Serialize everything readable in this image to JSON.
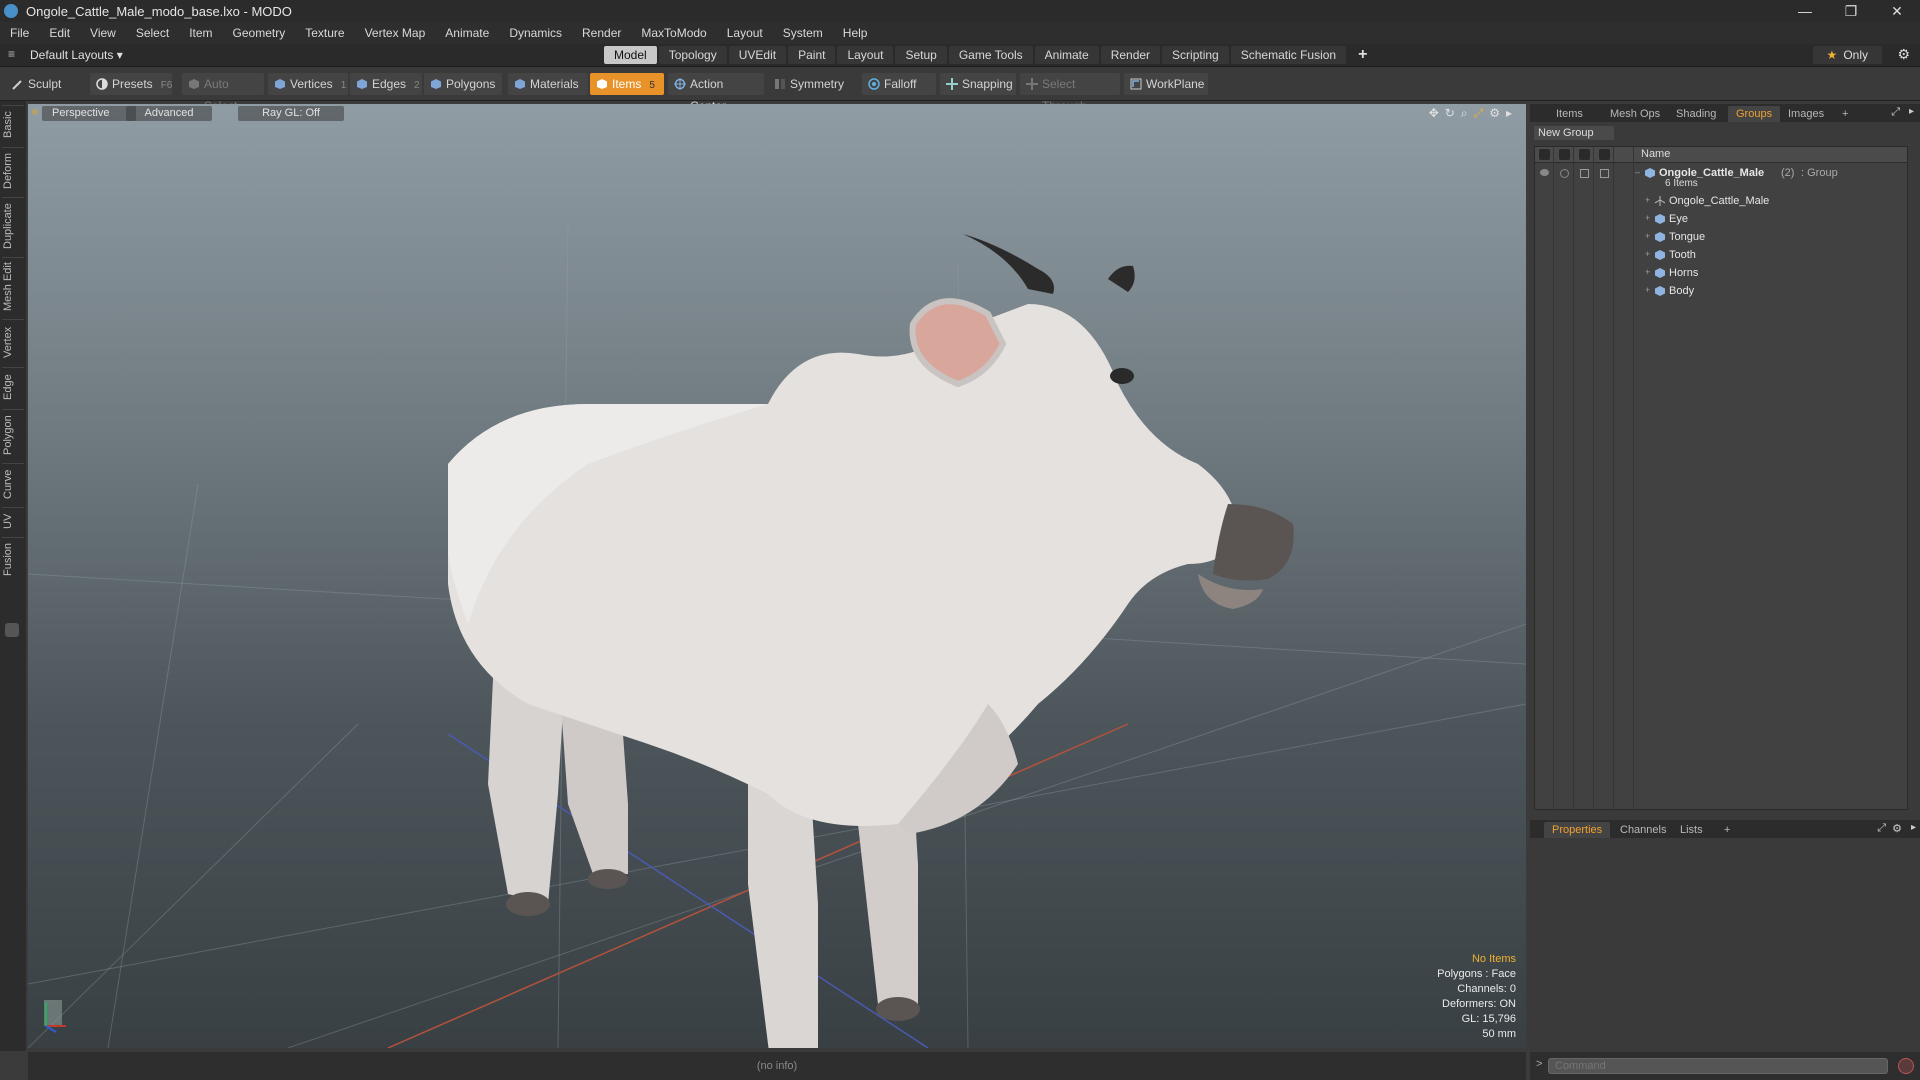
{
  "window": {
    "title": "Ongole_Cattle_Male_modo_base.lxo - MODO",
    "minimize": "—",
    "restore": "❐",
    "close": "✕"
  },
  "menu": [
    "File",
    "Edit",
    "View",
    "Select",
    "Item",
    "Geometry",
    "Texture",
    "Vertex Map",
    "Animate",
    "Dynamics",
    "Render",
    "MaxToModo",
    "Layout",
    "System",
    "Help"
  ],
  "layoutbar": {
    "layout_select": "Default Layouts ▾",
    "tabs": [
      "Model",
      "Topology",
      "UVEdit",
      "Paint",
      "Layout",
      "Setup",
      "Game Tools",
      "Animate",
      "Render",
      "Scripting",
      "Schematic Fusion"
    ],
    "active_tab": "Model",
    "add_tab": "+",
    "only_label": "Only",
    "star": "★",
    "gear": "⚙"
  },
  "toolbar": {
    "sculpt": "Sculpt",
    "presets": "Presets",
    "presets_key": "F6",
    "auto_select": "Auto Select",
    "vertices": "Vertices",
    "vertices_key": "1",
    "edges": "Edges",
    "edges_key": "2",
    "polygons": "Polygons",
    "materials": "Materials",
    "items": "Items",
    "items_key": "5",
    "action_center": "Action Center",
    "symmetry": "Symmetry",
    "falloff": "Falloff",
    "snapping": "Snapping",
    "select_through": "Select Through",
    "workplane": "WorkPlane"
  },
  "left_tabs": [
    "Basic",
    "Deform",
    "Duplicate",
    "Mesh Edit",
    "Vertex",
    "Edge",
    "Polygon",
    "Curve",
    "UV",
    "Fusion"
  ],
  "viewport": {
    "perspective": "Perspective",
    "advanced": "Advanced",
    "raygl": "Ray GL: Off",
    "info": {
      "no_items": "No Items",
      "polygons": "Polygons : Face",
      "channels": "Channels: 0",
      "deformers": "Deformers: ON",
      "gl": "GL: 15,796",
      "focal": "50 mm"
    },
    "colors": {
      "model": "#e4e1df",
      "model_shadow": "#b4afac",
      "hoof": "#5a5553",
      "horn": "#2b2b2b",
      "ear_inner": "#d9a69c"
    }
  },
  "status": {
    "info": "(no info)"
  },
  "right_panel": {
    "tabs": [
      "Items",
      "Mesh Ops",
      "Shading",
      "Groups",
      "Images",
      "+"
    ],
    "active_tab": "Groups",
    "new_group": "New Group",
    "name_header": "Name",
    "group": {
      "name": "Ongole_Cattle_Male",
      "count": "(2)",
      "type": ": Group",
      "sub": "6 Items"
    },
    "items": [
      {
        "label": "Ongole_Cattle_Male",
        "icon": "locator-icon"
      },
      {
        "label": "Eye",
        "icon": "mesh-icon"
      },
      {
        "label": "Tongue",
        "icon": "mesh-icon"
      },
      {
        "label": "Tooth",
        "icon": "mesh-icon"
      },
      {
        "label": "Horns",
        "icon": "mesh-icon"
      },
      {
        "label": "Body",
        "icon": "mesh-icon"
      }
    ],
    "bottom_tabs": [
      "Properties",
      "Channels",
      "Lists",
      "+"
    ],
    "bottom_active": "Properties",
    "command_placeholder": "Command",
    "command_prompt": ">"
  }
}
